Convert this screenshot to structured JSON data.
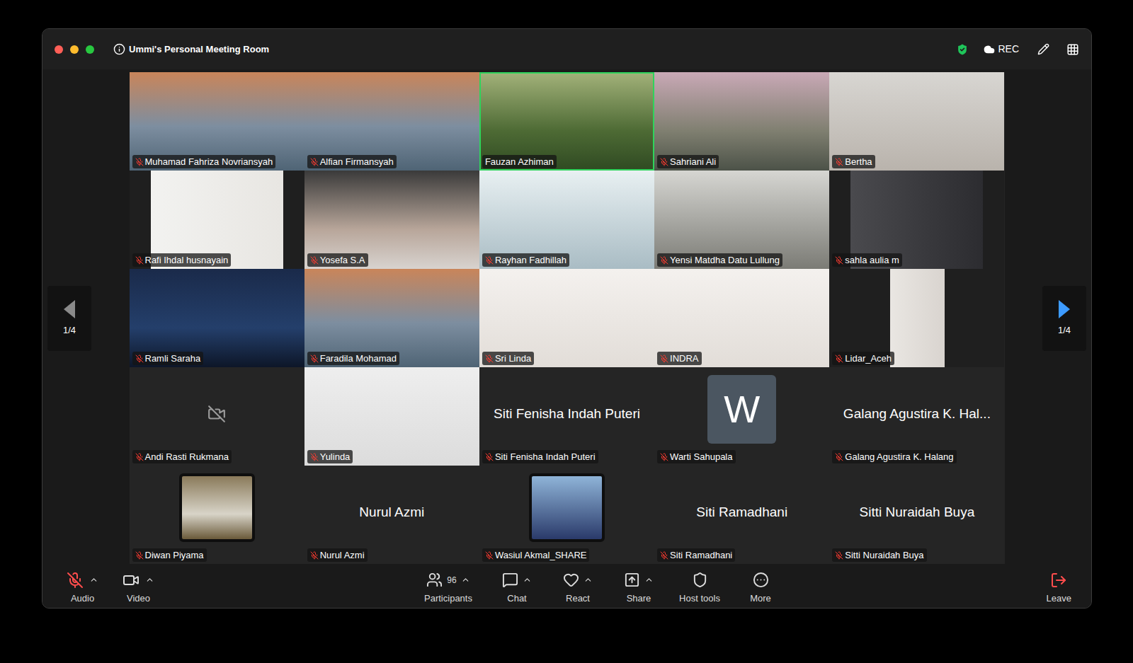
{
  "window": {
    "title": "Ummi's Personal Meeting Room",
    "recording": "REC"
  },
  "pager": {
    "left": {
      "label": "1/4",
      "enabled": false
    },
    "right": {
      "label": "1/4",
      "enabled": true
    }
  },
  "participants": [
    {
      "name": "Muhamad Fahriza Novriansyah",
      "kind": "video",
      "muted": true,
      "speaking": false
    },
    {
      "name": "Alfian Firmansyah",
      "kind": "video",
      "muted": true,
      "speaking": false
    },
    {
      "name": "Fauzan Azhiman",
      "kind": "video",
      "muted": false,
      "speaking": true
    },
    {
      "name": "Sahriani Ali",
      "kind": "video",
      "muted": true,
      "speaking": false
    },
    {
      "name": "Bertha",
      "kind": "video",
      "muted": true,
      "speaking": false
    },
    {
      "name": "Rafi Ihdal husnayain",
      "kind": "video",
      "muted": true,
      "speaking": false
    },
    {
      "name": "Yosefa S.A",
      "kind": "video",
      "muted": true,
      "speaking": false
    },
    {
      "name": "Rayhan Fadhillah",
      "kind": "video",
      "muted": true,
      "speaking": false
    },
    {
      "name": "Yensi Matdha Datu Lullung",
      "kind": "video",
      "muted": true,
      "speaking": false
    },
    {
      "name": "sahla aulia m",
      "kind": "video",
      "muted": true,
      "speaking": false
    },
    {
      "name": "Ramli Saraha",
      "kind": "video",
      "muted": true,
      "speaking": false
    },
    {
      "name": "Faradila Mohamad",
      "kind": "video",
      "muted": true,
      "speaking": false
    },
    {
      "name": "Sri Linda",
      "kind": "video",
      "muted": true,
      "speaking": false
    },
    {
      "name": "INDRA",
      "kind": "video",
      "muted": true,
      "speaking": false
    },
    {
      "name": "Lidar_Aceh",
      "kind": "video",
      "muted": true,
      "speaking": false
    },
    {
      "name": "Andi Rasti Rukmana",
      "kind": "camera-off",
      "muted": true,
      "speaking": false
    },
    {
      "name": "Yulinda",
      "kind": "video",
      "muted": true,
      "speaking": false
    },
    {
      "name": "Siti Fenisha Indah Puteri",
      "kind": "name",
      "display": "Siti Fenisha Indah Puteri",
      "muted": true,
      "speaking": false
    },
    {
      "name": "Warti Sahupala",
      "kind": "initial",
      "display": "W",
      "muted": true,
      "speaking": false
    },
    {
      "name": "Galang Agustira K. Halang",
      "kind": "name",
      "display": "Galang Agustira K. Hal...",
      "muted": true,
      "speaking": false
    },
    {
      "name": "Diwan Piyama",
      "kind": "picture",
      "muted": true,
      "speaking": false
    },
    {
      "name": "Nurul Azmi",
      "kind": "name",
      "display": "Nurul Azmi",
      "muted": true,
      "speaking": false
    },
    {
      "name": "Wasiul Akmal_SHARE",
      "kind": "picture",
      "muted": true,
      "speaking": false
    },
    {
      "name": "Siti Ramadhani",
      "kind": "name",
      "display": "Siti Ramadhani",
      "muted": true,
      "speaking": false
    },
    {
      "name": "Sitti Nuraidah Buya",
      "kind": "name",
      "display": "Sitti Nuraidah Buya",
      "muted": true,
      "speaking": false
    }
  ],
  "toolbar": {
    "left": [
      {
        "label": "Audio",
        "muted": true,
        "menu": true
      },
      {
        "label": "Video",
        "muted": false,
        "menu": true
      }
    ],
    "center": [
      {
        "label": "Participants",
        "count": "96",
        "menu": true
      },
      {
        "label": "Chat",
        "count": "",
        "menu": true
      },
      {
        "label": "React",
        "count": "",
        "menu": true
      },
      {
        "label": "Share",
        "count": "",
        "menu": true
      },
      {
        "label": "Host tools",
        "count": "",
        "menu": false
      },
      {
        "label": "More",
        "count": "",
        "menu": false
      }
    ],
    "leave": "Leave"
  }
}
